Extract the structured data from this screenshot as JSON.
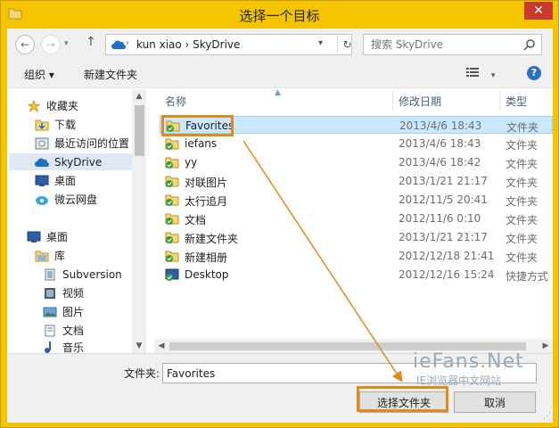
{
  "window": {
    "title": "选择一个目标"
  },
  "address": {
    "path": "kun xiao  ›  SkyDrive"
  },
  "search": {
    "placeholder": "搜索 SkyDrive"
  },
  "toolbar": {
    "organize": "组织 ▾",
    "new_folder": "新建文件夹"
  },
  "navpane": {
    "items": [
      {
        "label": "收藏夹",
        "icon": "star-icon"
      },
      {
        "label": "下载",
        "icon": "download-folder-icon"
      },
      {
        "label": "最近访问的位置",
        "icon": "recent-places-icon"
      },
      {
        "label": "SkyDrive",
        "icon": "skydrive-icon"
      },
      {
        "label": "桌面",
        "icon": "desktop-icon"
      },
      {
        "label": "微云网盘",
        "icon": "weiyun-icon"
      },
      {
        "label": "桌面",
        "icon": "desktop-icon"
      },
      {
        "label": "库",
        "icon": "library-icon"
      },
      {
        "label": "Subversion",
        "icon": "library-folder-icon"
      },
      {
        "label": "视频",
        "icon": "video-icon"
      },
      {
        "label": "图片",
        "icon": "picture-icon"
      },
      {
        "label": "文档",
        "icon": "document-icon"
      },
      {
        "label": "音乐",
        "icon": "music-icon"
      }
    ]
  },
  "filelist": {
    "columns": {
      "name": "名称",
      "date": "修改日期",
      "type": "类型"
    },
    "rows": [
      {
        "name": "Favorites",
        "date": "2013/4/6 18:43",
        "type": "文件夹"
      },
      {
        "name": "iefans",
        "date": "2013/4/6 18:43",
        "type": "文件夹"
      },
      {
        "name": "yy",
        "date": "2013/4/6 18:42",
        "type": "文件夹"
      },
      {
        "name": "对联图片",
        "date": "2013/1/21 21:17",
        "type": "文件夹"
      },
      {
        "name": "太行追月",
        "date": "2012/11/5 20:41",
        "type": "文件夹"
      },
      {
        "name": "文档",
        "date": "2012/11/6 0:10",
        "type": "文件夹"
      },
      {
        "name": "新建文件夹",
        "date": "2013/1/21 21:17",
        "type": "文件夹"
      },
      {
        "name": "新建相册",
        "date": "2012/12/18 21:41",
        "type": "文件夹"
      },
      {
        "name": "Desktop",
        "date": "2012/12/16 15:24",
        "type": "快捷方式"
      }
    ]
  },
  "bottom": {
    "folder_label": "文件夹:",
    "folder_value": "Favorites",
    "select_button": "选择文件夹",
    "cancel_button": "取消"
  },
  "watermark": {
    "line1": "ieFans.Net",
    "line2": "IE浏览器中文网站"
  },
  "colors": {
    "accent_orange": "#e08a1c",
    "selection": "#cce8ff",
    "title_bar": "#f5c400",
    "close": "#c7392d"
  }
}
